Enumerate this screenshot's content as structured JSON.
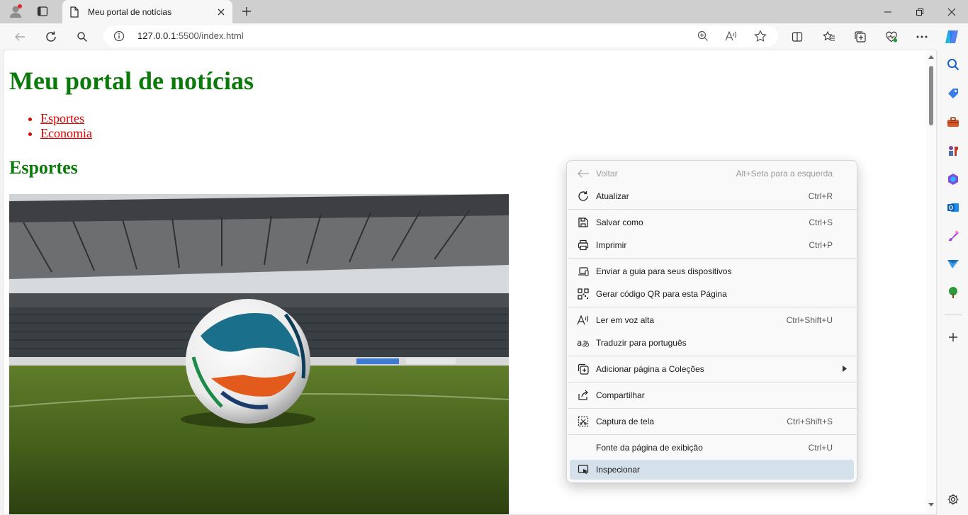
{
  "tab": {
    "title": "Meu portal de notícias"
  },
  "address": {
    "host": "127.0.0.1",
    "path": ":5500/index.html"
  },
  "page": {
    "heading": "Meu portal de notícias",
    "nav": [
      "Esportes",
      "Economia"
    ],
    "section_title": "Esportes"
  },
  "context_menu": {
    "back": {
      "label": "Voltar",
      "shortcut": "Alt+Seta para a esquerda"
    },
    "refresh": {
      "label": "Atualizar",
      "shortcut": "Ctrl+R"
    },
    "save_as": {
      "label": "Salvar como",
      "shortcut": "Ctrl+S"
    },
    "print": {
      "label": "Imprimir",
      "shortcut": "Ctrl+P"
    },
    "send_tab": {
      "label": "Enviar a guia para seus dispositivos"
    },
    "qr_code": {
      "label": "Gerar código QR para esta Página"
    },
    "read_aloud": {
      "label": "Ler em voz alta",
      "shortcut": "Ctrl+Shift+U"
    },
    "translate": {
      "label": "Traduzir para português"
    },
    "add_collection": {
      "label": "Adicionar página a Coleções"
    },
    "share": {
      "label": "Compartilhar"
    },
    "screenshot": {
      "label": "Captura de tela",
      "shortcut": "Ctrl+Shift+S"
    },
    "view_source": {
      "label": "Fonte da página de exibição",
      "shortcut": "Ctrl+U"
    },
    "inspect": {
      "label": "Inspecionar"
    }
  },
  "colors": {
    "heading": "#0a7a0a",
    "link": "#e00000",
    "menu_hover": "#d5e1ea"
  }
}
